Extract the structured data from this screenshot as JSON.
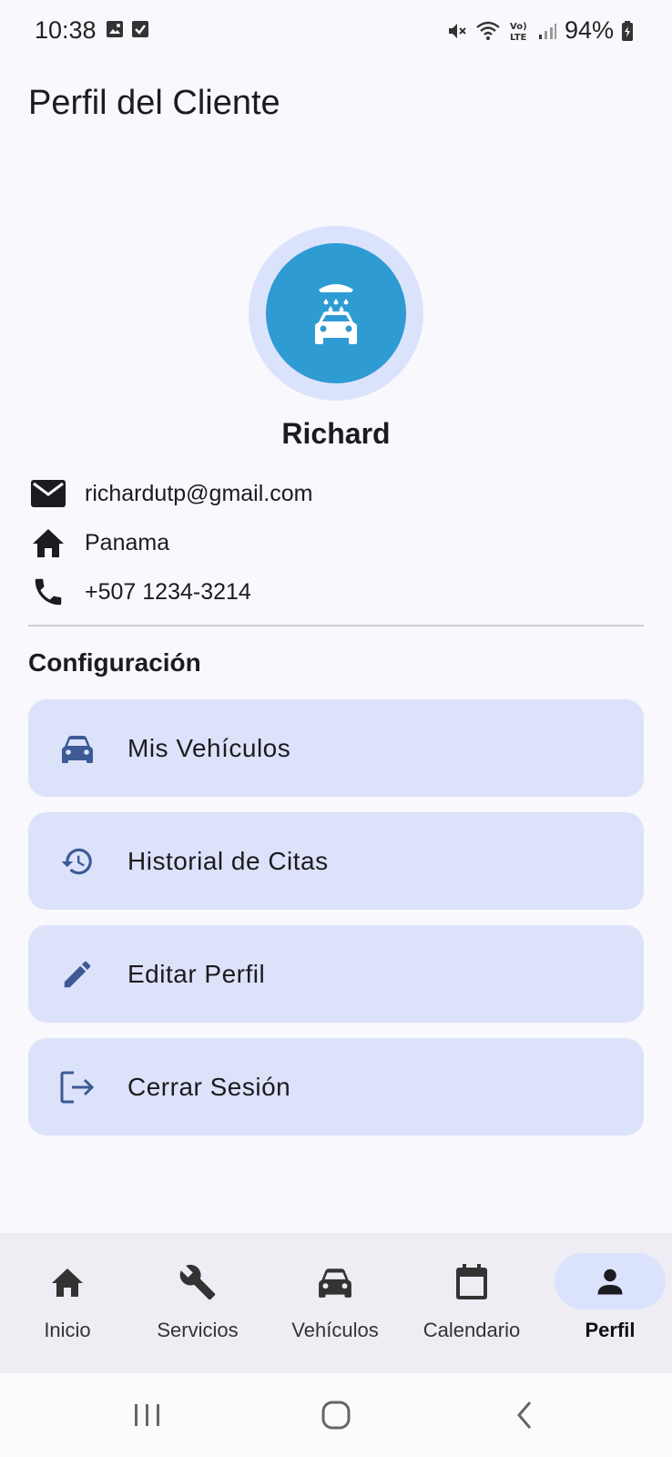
{
  "status_bar": {
    "time": "10:38",
    "battery": "94%",
    "left_icons": [
      "image-icon",
      "checkbox-icon"
    ],
    "right_icons": [
      "mute-icon",
      "wifi-icon",
      "volte-icon",
      "signal-icon",
      "battery-icon"
    ]
  },
  "header": {
    "title": "Perfil del Cliente"
  },
  "profile": {
    "avatar_icon": "car-wash-icon",
    "avatar_color": "#2e9bd2",
    "name": "Richard",
    "email": "richardutp@gmail.com",
    "location": "Panama",
    "phone": "+507 1234-3214"
  },
  "settings": {
    "title": "Configuración",
    "items": [
      {
        "label": "Mis Vehículos",
        "icon": "car-icon"
      },
      {
        "label": "Historial de Citas",
        "icon": "history-icon"
      },
      {
        "label": "Editar Perfil",
        "icon": "pencil-icon"
      },
      {
        "label": "Cerrar Sesión",
        "icon": "logout-icon"
      }
    ]
  },
  "bottom_nav": {
    "active": "Perfil",
    "items": [
      {
        "label": "Inicio",
        "icon": "home-icon"
      },
      {
        "label": "Servicios",
        "icon": "wrench-icon"
      },
      {
        "label": "Vehículos",
        "icon": "car-icon"
      },
      {
        "label": "Calendario",
        "icon": "calendar-icon"
      },
      {
        "label": "Perfil",
        "icon": "person-icon"
      }
    ]
  },
  "colors": {
    "background": "#f9f8fd",
    "card": "#dce2f9",
    "accent_icon": "#3d5a95",
    "nav_pill": "#dbe3fc"
  }
}
